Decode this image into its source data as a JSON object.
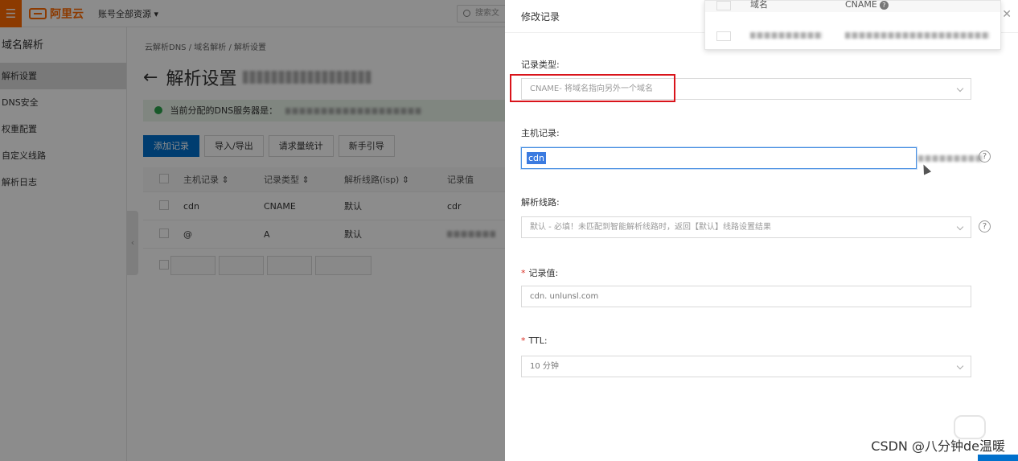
{
  "topbar": {
    "menu_icon": "hamburger-icon",
    "logo_text": "阿里云",
    "account_label": "账号全部资源",
    "search_placeholder": "搜索文"
  },
  "sidebar": {
    "title": "域名解析",
    "items": [
      {
        "label": "解析设置",
        "active": true
      },
      {
        "label": "DNS安全",
        "active": false
      },
      {
        "label": "权重配置",
        "active": false
      },
      {
        "label": "自定义线路",
        "active": false
      },
      {
        "label": "解析日志",
        "active": false
      }
    ]
  },
  "main": {
    "breadcrumb": [
      "云解析DNS",
      "域名解析",
      "解析设置"
    ],
    "page_title": "解析设置",
    "notice": "当前分配的DNS服务器是：",
    "buttons": [
      "添加记录",
      "导入/导出",
      "请求量统计",
      "新手引导"
    ],
    "columns": [
      "主机记录",
      "记录类型",
      "解析线路(isp)",
      "记录值"
    ],
    "rows": [
      {
        "host": "cdn",
        "type": "CNAME",
        "line": "默认",
        "value": "cdr"
      },
      {
        "host": "@",
        "type": "A",
        "line": "默认",
        "value": ""
      }
    ]
  },
  "drawer": {
    "title": "修改记录",
    "popup_columns": [
      "域名",
      "CNAME"
    ],
    "record_type_label": "记录类型:",
    "record_type_value": "CNAME- 将域名指向另外一个域名",
    "host_label": "主机记录:",
    "host_value": "cdn",
    "line_label": "解析线路:",
    "line_value": "默认 - 必填！未匹配到智能解析线路时，返回【默认】线路设置结果",
    "value_label": "记录值:",
    "value_value": "cdn.                    unlunsl.com",
    "ttl_label": "TTL:",
    "ttl_value": "10 分钟"
  },
  "watermark": "CSDN @八分钟de温暖",
  "accent_color": "#ff6a00",
  "primary_color": "#0070cc",
  "highlight_color": "#d9141b"
}
